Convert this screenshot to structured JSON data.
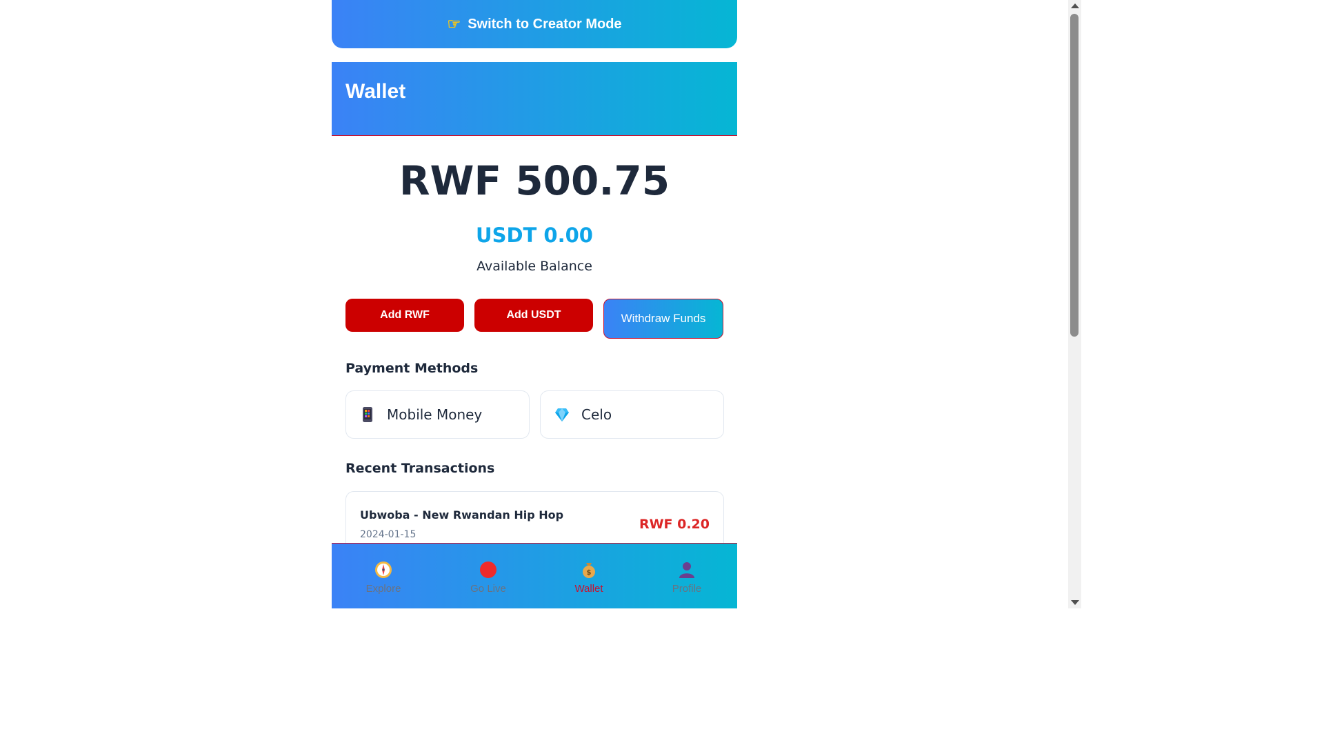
{
  "creator_switch": {
    "label": "Switch to Creator Mode",
    "icon": "pointing-hand-icon"
  },
  "header": {
    "title": "Wallet"
  },
  "balance": {
    "primary": "RWF 500.75",
    "secondary": "USDT 0.00",
    "label": "Available Balance"
  },
  "actions": {
    "add_rwf": "Add RWF",
    "add_usdt": "Add USDT",
    "withdraw": "Withdraw Funds"
  },
  "payment_methods": {
    "title": "Payment Methods",
    "items": [
      {
        "label": "Mobile Money",
        "icon": "mobile-phone-icon"
      },
      {
        "label": "Celo",
        "icon": "diamond-icon"
      }
    ]
  },
  "transactions": {
    "title": "Recent Transactions",
    "items": [
      {
        "name": "Ubwoba - New Rwandan Hip Hop",
        "date": "2024-01-15",
        "amount": "RWF 0.20"
      }
    ]
  },
  "bottom_nav": {
    "items": [
      {
        "label": "Explore",
        "icon": "compass-icon",
        "active": false
      },
      {
        "label": "Go Live",
        "icon": "red-circle-icon",
        "active": false
      },
      {
        "label": "Wallet",
        "icon": "money-bag-icon",
        "active": true
      },
      {
        "label": "Profile",
        "icon": "person-icon",
        "active": false
      }
    ]
  },
  "colors": {
    "gradient_start": "#3b82f6",
    "gradient_end": "#06b6d4",
    "primary_red": "#cc0000",
    "active_nav": "#c8102e",
    "balance_text": "#1e293b",
    "usdt_text": "#0ea5e9",
    "amount_red": "#dc2626"
  }
}
